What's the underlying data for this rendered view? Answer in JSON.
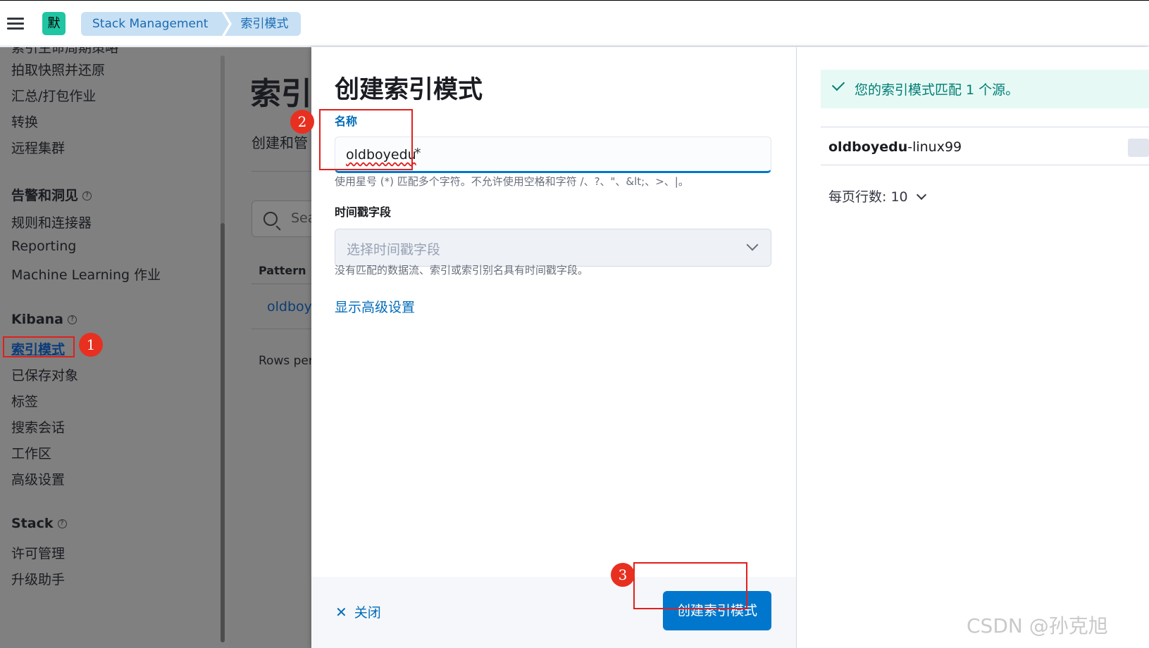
{
  "header": {
    "space_initial": "默",
    "breadcrumbs": [
      "Stack Management",
      "索引模式"
    ]
  },
  "sidenav": {
    "partial_top": "索引生命周期策略",
    "group0": [
      "拍取快照并还原",
      "汇总/打包作业",
      "转换",
      "远程集群"
    ],
    "group1_title": "告警和洞见",
    "group1": [
      "规则和连接器",
      "Reporting",
      "Machine Learning 作业"
    ],
    "group2_title": "Kibana",
    "group2": [
      "索引模式",
      "已保存对象",
      "标签",
      "搜索会话",
      "工作区",
      "高级设置"
    ],
    "group3_title": "Stack",
    "group3": [
      "许可管理",
      "升级助手"
    ],
    "help_glyph": "?"
  },
  "bg_page": {
    "title": "索引",
    "subtitle": "创建和管",
    "search_placeholder": "Sea",
    "col_pattern": "Pattern ↑",
    "row_link": "oldboy",
    "rows_per": "Rows per"
  },
  "flyout": {
    "title": "创建索引模式",
    "name_label": "名称",
    "name_value": "oldboyedu",
    "name_suffix": "*",
    "name_help": "使用星号 (*) 匹配多个字符。不允许使用空格和字符 /、?、\"、&lt;、>、|。",
    "timestamp_label": "时间戳字段",
    "timestamp_placeholder": "选择时间戳字段",
    "timestamp_help": "没有匹配的数据流、索引或索引别名具有时间戳字段。",
    "advanced_link": "显示高级设置",
    "close_label": "关闭",
    "create_label": "创建索引模式"
  },
  "results": {
    "callout": "您的索引模式匹配 1 个源。",
    "match_bold": "oldboyedu",
    "match_rest": "-linux99",
    "rows_per_page": "每页行数: 10"
  },
  "annotations": [
    "1",
    "2",
    "3"
  ],
  "watermark": "CSDN @孙克旭",
  "colors": {
    "primary": "#0077cc",
    "success_bg": "#e6f9f5",
    "success_text": "#017d73",
    "annotation_red": "#e0201c",
    "space_avatar": "#20c5a3"
  }
}
